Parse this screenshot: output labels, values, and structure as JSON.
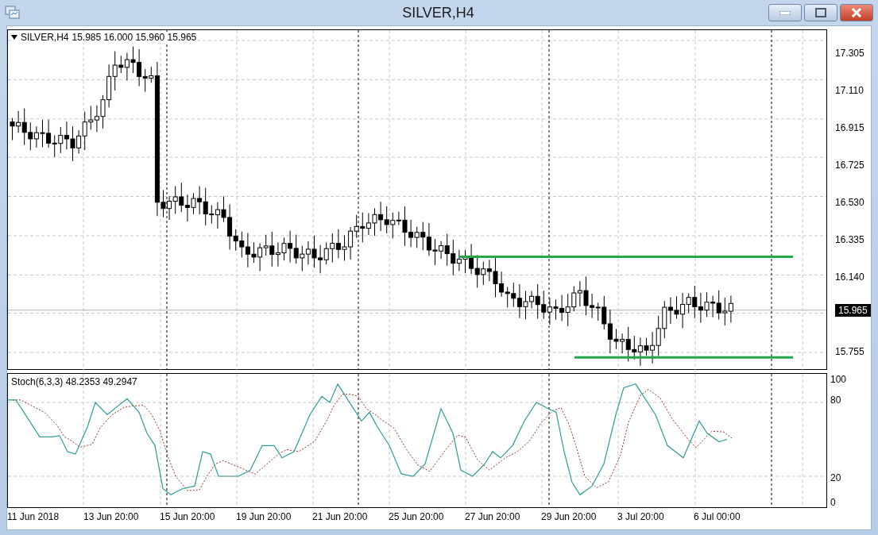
{
  "window": {
    "title": "SILVER,H4"
  },
  "chart": {
    "symbol": "SILVER,H4",
    "quote": "15.985 16.000 15.960 15.965",
    "price_labels": [
      "17.305",
      "17.110",
      "16.915",
      "16.725",
      "16.530",
      "16.335",
      "16.140"
    ],
    "current_price": "15.965",
    "bottom_price_label": "15.755"
  },
  "indicator": {
    "label": "Stoch(6,3,3) 48.2353 49.2947",
    "levels": [
      "100",
      "80",
      "20",
      "0"
    ]
  },
  "time_labels": [
    "11 Jun 2018",
    "13 Jun 20:00",
    "15 Jun 20:00",
    "19 Jun 20:00",
    "21 Jun 20:00",
    "25 Jun 20:00",
    "27 Jun 20:00",
    "29 Jun 20:00",
    "3 Jul 20:00",
    "6 Jul 00:00"
  ]
}
